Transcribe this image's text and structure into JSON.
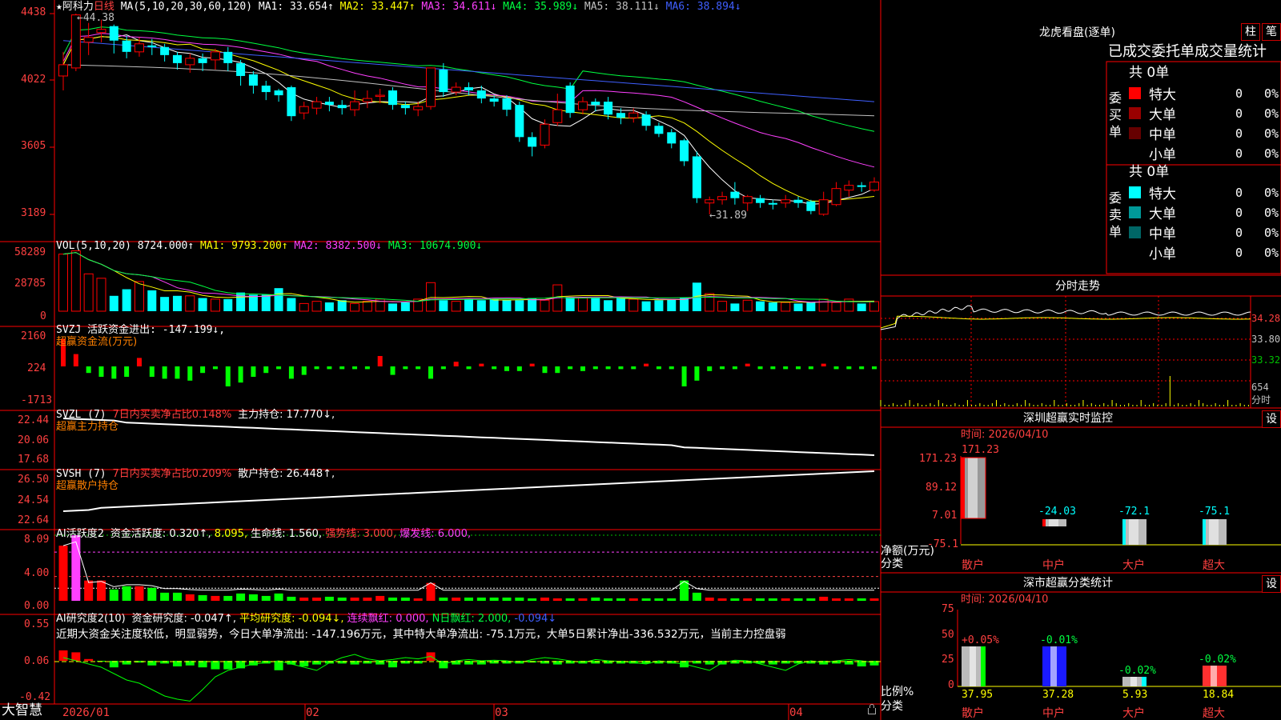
{
  "stock": {
    "star": "★",
    "name": "阿科力",
    "period": "日线"
  },
  "ma_line": {
    "prefix": "MA(5,10,20,30,60,120)",
    "items": [
      {
        "label": "MA1: 33.654↑",
        "color": "#ffffff"
      },
      {
        "label": "MA2: 33.447↑",
        "color": "#ffff00"
      },
      {
        "label": "MA3: 34.611↓",
        "color": "#ff40ff"
      },
      {
        "label": "MA4: 35.989↓",
        "color": "#00ff40"
      },
      {
        "label": "MA5: 38.111↓",
        "color": "#c0c0c0"
      },
      {
        "label": "MA6: 38.894↓",
        "color": "#3f5fff"
      }
    ]
  },
  "price_axis": {
    "ticks": [
      "4438",
      "4022",
      "3605",
      "3189"
    ],
    "high_note": "←44.38",
    "low_note": "←31.89"
  },
  "vol_panel": {
    "prefix": "VOL(5,10,20)",
    "value": "8724.000↑",
    "items": [
      {
        "label": "MA1: 9793.200↑",
        "color": "#ffff00"
      },
      {
        "label": "MA2: 8382.500↓",
        "color": "#ff40ff"
      },
      {
        "label": "MA3: 10674.900↓",
        "color": "#00ff40"
      }
    ],
    "ticks": [
      "58289",
      "28785",
      "0"
    ]
  },
  "svzj_panel": {
    "line1": "SVZJ  活跃资金进出: -147.199↓,",
    "line2": "超赢资金流(万元)",
    "ticks": [
      "2160",
      "224",
      "-1713"
    ]
  },
  "svzl_panel": {
    "prefix": "SVZL (7)",
    "red_text": "7日内买卖净占比0.148%",
    "white_text": "主力持仓: 17.770↓,",
    "line2": "超赢主力持仓",
    "ticks": [
      "22.44",
      "20.06",
      "17.68"
    ]
  },
  "svsh_panel": {
    "prefix": "SVSH (7)",
    "red_text": "7日内买卖净占比0.209%",
    "white_text": "散户持仓: 26.448↑,",
    "line2": "超赢散户持仓",
    "ticks": [
      "26.50",
      "24.54",
      "22.64"
    ]
  },
  "ai_panel": {
    "prefix": "AI活跃度2",
    "items": [
      {
        "label": "资金活跃度: 0.320↑,",
        "color": "#ffffff"
      },
      {
        "label": "8.095,",
        "color": "#ffff00"
      },
      {
        "label": "生命线: 1.560,",
        "color": "#ffffff"
      },
      {
        "label": "强势线: 3.000,",
        "color": "#ff4040"
      },
      {
        "label": "爆发线: 6.000,",
        "color": "#ff40ff"
      }
    ],
    "ticks": [
      "8.09",
      "4.00",
      "0.00"
    ]
  },
  "ai_research": {
    "prefix": "AI研究度2(10)",
    "items": [
      {
        "label": "资金研究度: -0.047↑,",
        "color": "#ffffff"
      },
      {
        "label": "平均研究度: -0.094↓,",
        "color": "#ffff00"
      },
      {
        "label": "连续飘红: 0.000,",
        "color": "#ff40ff"
      },
      {
        "label": "N日飘红: 2.000,",
        "color": "#00ff40"
      },
      {
        "label": "-0.094↓",
        "color": "#3f5fff"
      }
    ],
    "comment": "近期大资金关注度较低，明显弱势，今日大单净流出: -147.196万元，其中特大单净流出: -75.1万元，大单5日累计净出-336.532万元，当前主力控盘弱",
    "ticks": [
      "0.55",
      "0.06",
      "-0.42"
    ]
  },
  "date_axis": {
    "logo": "大智慧",
    "labels": [
      "2026/01",
      "02",
      "03",
      "04"
    ]
  },
  "right_panel": {
    "dragon_title": "龙虎看盘(逐单)",
    "btn_zhu": "柱",
    "btn_bi": "笔",
    "tabs_header": "已成交委托单成交量统计",
    "buy": {
      "side_label": [
        "委",
        "买",
        "单"
      ],
      "total": "共 0单",
      "rows": [
        {
          "label": "特大",
          "color": "#ff0000",
          "count": "0",
          "pct": "0%"
        },
        {
          "label": "大单",
          "color": "#990000",
          "count": "0",
          "pct": "0%"
        },
        {
          "label": "中单",
          "color": "#660000",
          "count": "0",
          "pct": "0%"
        },
        {
          "label": "小单",
          "color": "#000000",
          "count": "0",
          "pct": "0%"
        }
      ]
    },
    "sell": {
      "side_label": [
        "委",
        "卖",
        "单"
      ],
      "total": "共 0单",
      "rows": [
        {
          "label": "特大",
          "color": "#00ffff",
          "count": "0",
          "pct": "0%"
        },
        {
          "label": "大单",
          "color": "#009999",
          "count": "0",
          "pct": "0%"
        },
        {
          "label": "中单",
          "color": "#006666",
          "count": "0",
          "pct": "0%"
        },
        {
          "label": "小单",
          "color": "#000000",
          "count": "0",
          "pct": "0%"
        }
      ]
    },
    "intraday_title": "分时走势",
    "intraday_ticks": [
      "34.28",
      "33.80",
      "33.32",
      "654",
      "分时"
    ],
    "monitor": {
      "title": "深圳超赢实时监控",
      "settings": "设",
      "time": "时间: 2026/04/10",
      "y_ticks": [
        "171.23",
        "89.12",
        "7.01",
        "-75.1"
      ],
      "ylabel": "净额(万元)",
      "xlabel": "分类",
      "bars": [
        {
          "label": "散户",
          "value": "171.23"
        },
        {
          "label": "中户",
          "value": "-24.03"
        },
        {
          "label": "大户",
          "value": "-72.1"
        },
        {
          "label": "超大",
          "value": "-75.1"
        }
      ]
    },
    "classify": {
      "title": "深市超赢分类统计",
      "settings": "设",
      "time": "时间: 2026/04/10",
      "y_ticks": [
        "75",
        "50",
        "25",
        "0"
      ],
      "ylabel": "比例%",
      "xlabel": "分类",
      "bars": [
        {
          "label": "散户",
          "value": "37.95",
          "pct": "+0.05%"
        },
        {
          "label": "中户",
          "value": "37.28",
          "pct": "-0.01%"
        },
        {
          "label": "大户",
          "value": "5.93",
          "pct": "-0.02%"
        },
        {
          "label": "超大",
          "value": "18.84",
          "pct": "-0.02%"
        }
      ]
    }
  },
  "chart_data": [
    {
      "type": "candlestick",
      "title": "阿科力 日线",
      "ylim": [
        31.0,
        44.6
      ],
      "candles": [
        [
          40.5,
          41.2,
          39.6,
          42.0
        ],
        [
          41.0,
          44.3,
          40.8,
          44.38
        ],
        [
          42.6,
          42.9,
          41.8,
          43.8
        ],
        [
          43.2,
          43.4,
          42.6,
          44.0
        ],
        [
          43.6,
          42.7,
          41.9,
          43.7
        ],
        [
          42.7,
          42.0,
          41.6,
          43.0
        ],
        [
          42.0,
          42.5,
          41.7,
          42.9
        ],
        [
          42.4,
          42.3,
          41.8,
          42.8
        ],
        [
          42.3,
          41.8,
          41.4,
          42.5
        ],
        [
          41.8,
          41.3,
          40.9,
          42.0
        ],
        [
          41.2,
          41.6,
          40.7,
          41.9
        ],
        [
          41.6,
          41.3,
          40.8,
          41.9
        ],
        [
          41.5,
          42.0,
          40.9,
          42.2
        ],
        [
          42.0,
          41.3,
          40.8,
          42.3
        ],
        [
          41.3,
          40.5,
          39.9,
          41.5
        ],
        [
          40.6,
          39.9,
          39.4,
          40.8
        ],
        [
          39.9,
          39.5,
          39.0,
          40.2
        ],
        [
          39.6,
          39.3,
          38.9,
          39.7
        ],
        [
          39.8,
          38.0,
          37.7,
          39.9
        ],
        [
          38.2,
          38.6,
          37.8,
          38.9
        ],
        [
          38.5,
          38.9,
          38.1,
          39.2
        ],
        [
          38.9,
          38.7,
          38.3,
          39.2
        ],
        [
          38.7,
          38.5,
          38.1,
          39.0
        ],
        [
          38.4,
          38.9,
          38.0,
          39.6
        ],
        [
          38.9,
          39.1,
          38.5,
          39.6
        ],
        [
          39.3,
          39.3,
          38.8,
          39.7
        ],
        [
          39.6,
          38.7,
          38.4,
          39.8
        ],
        [
          38.7,
          38.5,
          38.1,
          38.9
        ],
        [
          38.4,
          38.6,
          38.0,
          38.9
        ],
        [
          38.6,
          41.0,
          38.4,
          41.0
        ],
        [
          40.9,
          39.5,
          39.2,
          41.3
        ],
        [
          39.5,
          39.8,
          39.3,
          40.1
        ],
        [
          39.8,
          39.6,
          39.3,
          40.1
        ],
        [
          39.6,
          39.1,
          38.8,
          39.9
        ],
        [
          39.1,
          38.9,
          38.6,
          39.3
        ],
        [
          39.1,
          38.4,
          38.0,
          39.3
        ],
        [
          38.7,
          36.7,
          36.4,
          38.9
        ],
        [
          36.7,
          36.1,
          35.5,
          37.0
        ],
        [
          36.2,
          37.5,
          36.0,
          37.8
        ],
        [
          37.6,
          38.4,
          37.4,
          39.4
        ],
        [
          39.9,
          38.2,
          37.9,
          40.1
        ],
        [
          38.4,
          38.9,
          38.1,
          39.2
        ],
        [
          38.9,
          38.7,
          38.3,
          39.1
        ],
        [
          38.9,
          38.1,
          37.8,
          39.2
        ],
        [
          38.2,
          37.9,
          37.5,
          38.5
        ],
        [
          37.9,
          38.2,
          37.6,
          38.5
        ],
        [
          38.1,
          37.4,
          37.1,
          38.3
        ],
        [
          37.4,
          36.9,
          36.7,
          37.6
        ],
        [
          37.0,
          36.3,
          36.0,
          37.2
        ],
        [
          36.5,
          35.2,
          34.9,
          36.6
        ],
        [
          35.5,
          32.9,
          32.6,
          35.8
        ],
        [
          32.6,
          32.8,
          31.89,
          33.0
        ],
        [
          32.8,
          33.0,
          32.5,
          33.3
        ],
        [
          33.3,
          32.9,
          32.5,
          33.9
        ],
        [
          32.6,
          33.0,
          32.1,
          33.1
        ],
        [
          32.9,
          32.6,
          32.3,
          33.1
        ],
        [
          32.6,
          32.5,
          32.2,
          32.8
        ],
        [
          32.6,
          32.8,
          32.3,
          33.1
        ],
        [
          32.8,
          32.6,
          32.3,
          33.0
        ],
        [
          32.7,
          32.1,
          31.9,
          32.8
        ],
        [
          31.9,
          32.8,
          31.8,
          33.3
        ],
        [
          32.5,
          33.5,
          32.4,
          33.9
        ],
        [
          33.4,
          33.7,
          33.0,
          34.0
        ],
        [
          33.7,
          33.6,
          33.3,
          33.9
        ],
        [
          33.4,
          33.9,
          33.3,
          34.2
        ]
      ],
      "ma_names": [
        "MA1",
        "MA2",
        "MA3",
        "MA4",
        "MA5",
        "MA6"
      ]
    },
    {
      "type": "bar",
      "title": "VOL(5,10,20)",
      "ylim": [
        0,
        58289
      ],
      "values": [
        52000,
        55000,
        34000,
        30000,
        14000,
        20000,
        27000,
        19000,
        13000,
        14000,
        14000,
        12000,
        11000,
        11000,
        17000,
        15000,
        15000,
        21000,
        12000,
        7000,
        9000,
        8000,
        10000,
        7000,
        9000,
        11000,
        7000,
        8000,
        11000,
        26000,
        10000,
        9000,
        11000,
        10000,
        11000,
        10000,
        10000,
        12000,
        10000,
        24000,
        13000,
        12000,
        12000,
        10000,
        12000,
        11000,
        9000,
        10000,
        11000,
        12000,
        26000,
        16000,
        9000,
        7000,
        10000,
        9000,
        8000,
        8000,
        7000,
        8000,
        11000,
        8000,
        11000,
        7000,
        8724
      ]
    }
  ]
}
